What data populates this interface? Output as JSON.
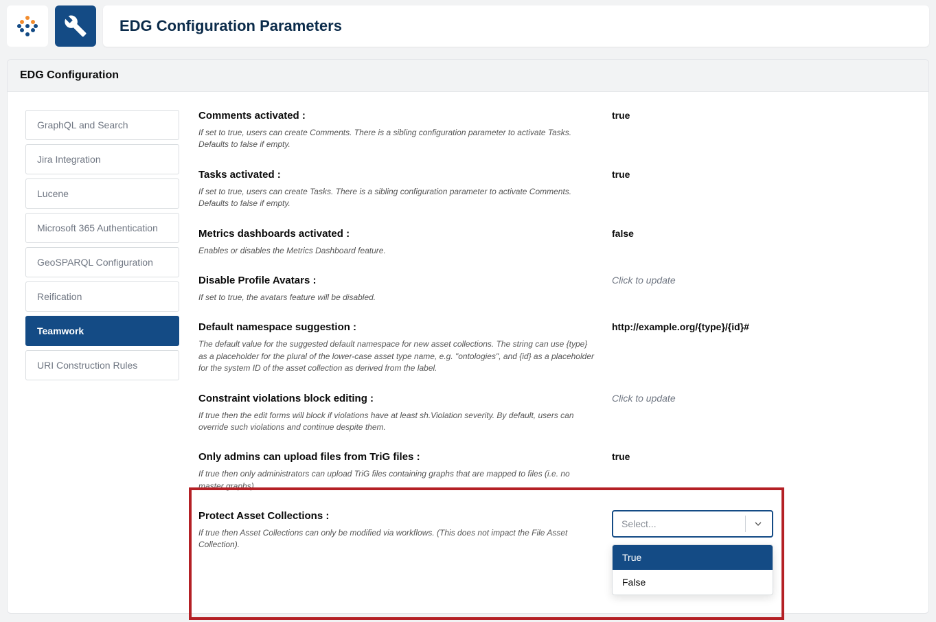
{
  "header": {
    "title": "EDG Configuration Parameters"
  },
  "section": {
    "title": "EDG Configuration"
  },
  "sidebar": {
    "items": [
      {
        "label": "GraphQL and Search",
        "active": false
      },
      {
        "label": "Jira Integration",
        "active": false
      },
      {
        "label": "Lucene",
        "active": false
      },
      {
        "label": "Microsoft 365 Authentication",
        "active": false
      },
      {
        "label": "GeoSPARQL Configuration",
        "active": false
      },
      {
        "label": "Reification",
        "active": false
      },
      {
        "label": "Teamwork",
        "active": true
      },
      {
        "label": "URI Construction Rules",
        "active": false
      }
    ]
  },
  "params": [
    {
      "title": "Comments activated :",
      "desc": "If set to true, users can create Comments. There is a sibling configuration parameter to activate Tasks. Defaults to false if empty.",
      "value": "true",
      "placeholder": false
    },
    {
      "title": "Tasks activated :",
      "desc": "If set to true, users can create Tasks. There is a sibling configuration parameter to activate Comments. Defaults to false if empty.",
      "value": "true",
      "placeholder": false
    },
    {
      "title": "Metrics dashboards activated :",
      "desc": "Enables or disables the Metrics Dashboard feature.",
      "value": "false",
      "placeholder": false
    },
    {
      "title": "Disable Profile Avatars :",
      "desc": "If set to true, the avatars feature will be disabled.",
      "value": "Click to update",
      "placeholder": true
    },
    {
      "title": "Default namespace suggestion :",
      "desc": "The default value for the suggested default namespace for new asset collections. The string can use {type} as a placeholder for the plural of the lower-case asset type name, e.g. \"ontologies\", and {id} as a placeholder for the system ID of the asset collection as derived from the label.",
      "value": "http://example.org/{type}/{id}#",
      "placeholder": false
    },
    {
      "title": "Constraint violations block editing :",
      "desc": "If true then the edit forms will block if violations have at least sh.Violation severity. By default, users can override such violations and continue despite them.",
      "value": "Click to update",
      "placeholder": true
    },
    {
      "title": "Only admins can upload files from TriG files :",
      "desc": "If true then only administrators can upload TriG files containing graphs that are mapped to files (i.e. no master graphs).",
      "value": "true",
      "placeholder": false
    }
  ],
  "protect": {
    "title": "Protect Asset Collections :",
    "desc": "If true then Asset Collections can only be modified via workflows. (This does not impact the File Asset Collection).",
    "select_placeholder": "Select...",
    "options": [
      {
        "label": "True",
        "selected": true
      },
      {
        "label": "False",
        "selected": false
      }
    ]
  }
}
